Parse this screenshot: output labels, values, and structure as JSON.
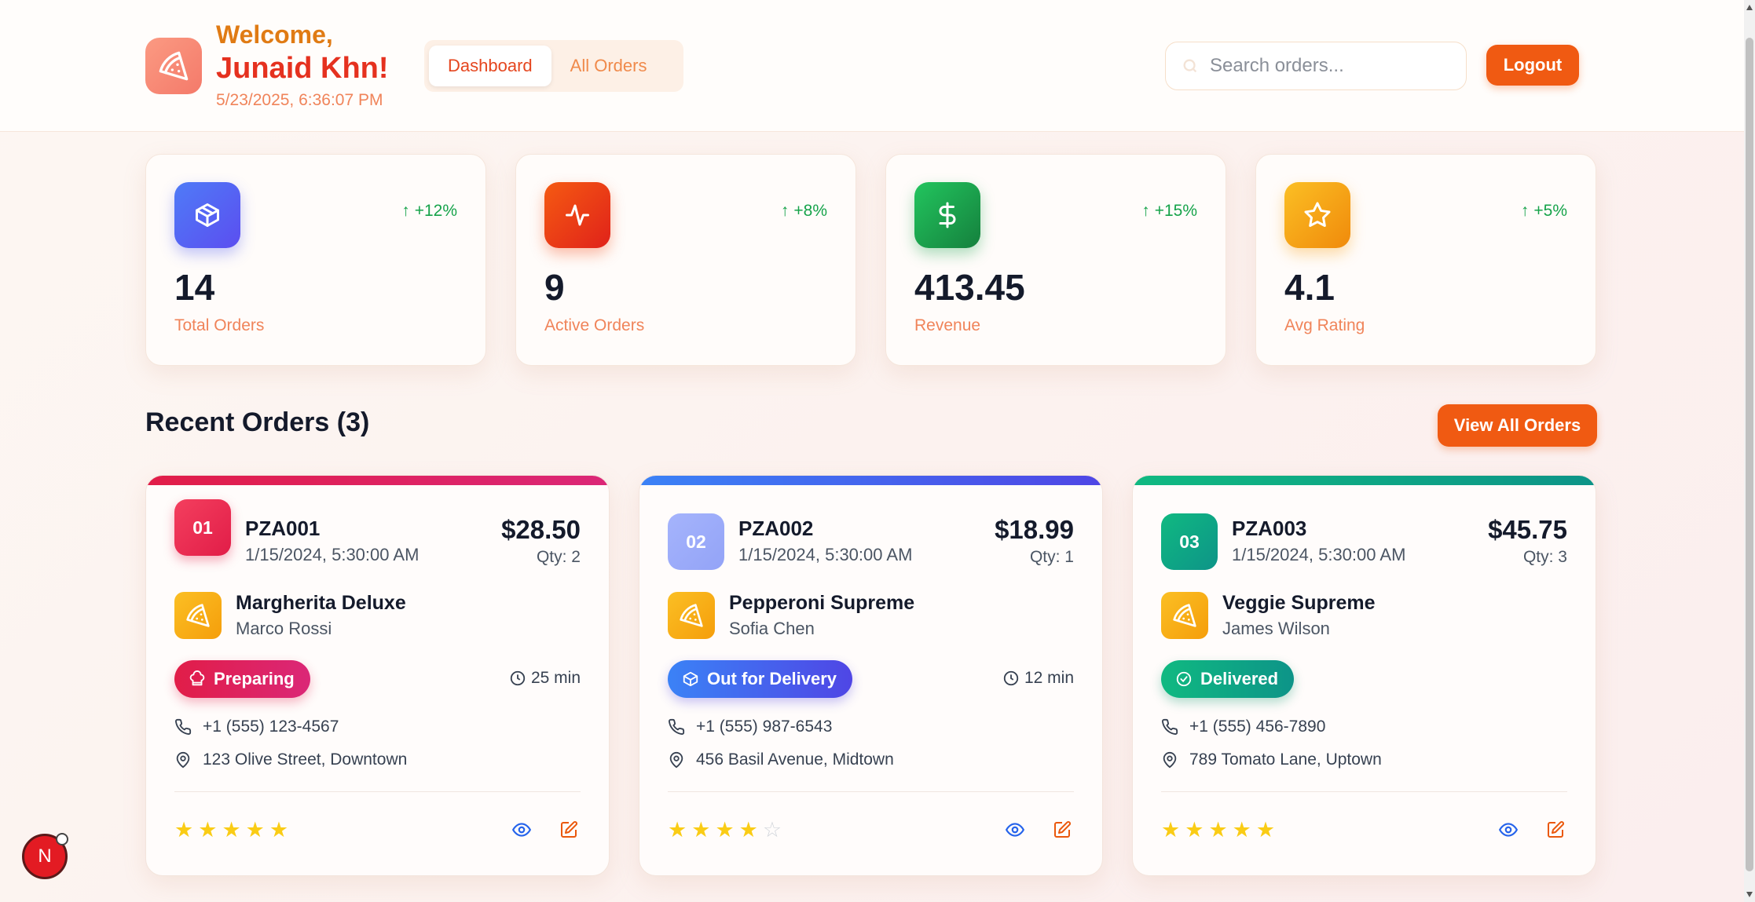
{
  "header": {
    "welcome": "Welcome,",
    "username": "Junaid Khn!",
    "datetime": "5/23/2025, 6:36:07 PM",
    "logo_icon": "pizza-icon",
    "tabs": [
      {
        "label": "Dashboard",
        "active": true
      },
      {
        "label": "All Orders",
        "active": false
      }
    ],
    "search": {
      "placeholder": "Search orders...",
      "value": ""
    },
    "logout_label": "Logout"
  },
  "stats": [
    {
      "icon": "package-icon",
      "trend": "+12%",
      "value": "14",
      "label": "Total Orders",
      "color": "#4f5ff0"
    },
    {
      "icon": "activity-icon",
      "trend": "+8%",
      "value": "9",
      "label": "Active Orders",
      "color": "#f0450d"
    },
    {
      "icon": "dollar-icon",
      "trend": "+15%",
      "value": "413.45",
      "label": "Revenue",
      "color": "#16a34a"
    },
    {
      "icon": "star-icon",
      "trend": "+5%",
      "value": "4.1",
      "label": "Avg Rating",
      "color": "#f59e0b"
    }
  ],
  "recent": {
    "title": "Recent Orders (3)",
    "view_all_label": "View All Orders"
  },
  "orders": [
    {
      "num": "01",
      "id": "PZA001",
      "date": "1/15/2024, 5:30:00 AM",
      "price": "$28.50",
      "qty": "Qty: 2",
      "pizza": "Margherita Deluxe",
      "customer": "Marco Rossi",
      "status": "Preparing",
      "status_icon": "chef-hat-icon",
      "time": "25 min",
      "phone": "+1 (555) 123-4567",
      "address": "123 Olive Street, Downtown",
      "rating": 5,
      "accent": "#e11d48"
    },
    {
      "num": "02",
      "id": "PZA002",
      "date": "1/15/2024, 5:30:00 AM",
      "price": "$18.99",
      "qty": "Qty: 1",
      "pizza": "Pepperoni Supreme",
      "customer": "Sofia Chen",
      "status": "Out for Delivery",
      "status_icon": "package-icon",
      "time": "12 min",
      "phone": "+1 (555) 987-6543",
      "address": "456 Basil Avenue, Midtown",
      "rating": 4,
      "accent": "#4f46e5"
    },
    {
      "num": "03",
      "id": "PZA003",
      "date": "1/15/2024, 5:30:00 AM",
      "price": "$45.75",
      "qty": "Qty: 3",
      "pizza": "Veggie Supreme",
      "customer": "James Wilson",
      "status": "Delivered",
      "status_icon": "check-circle-icon",
      "time": "",
      "phone": "+1 (555) 456-7890",
      "address": "789 Tomato Lane, Uptown",
      "rating": 5,
      "accent": "#059669"
    }
  ],
  "dev_badge": "N"
}
